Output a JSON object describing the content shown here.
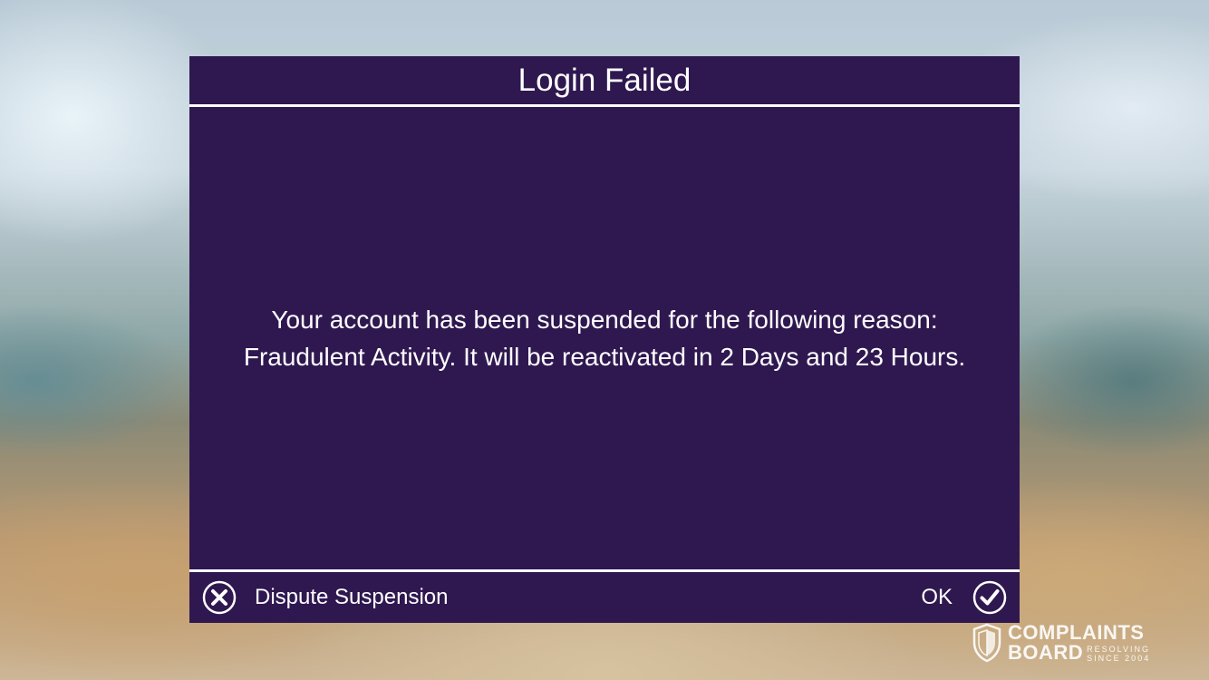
{
  "dialog": {
    "title": "Login Failed",
    "message": "Your account has been suspended for the following reason: Fraudulent Activity. It will be reactivated in 2 Days and 23 Hours.",
    "background_color": "#2f1850",
    "text_color": "#ffffff"
  },
  "footer": {
    "dispute": {
      "label": "Dispute Suspension",
      "icon": "x-circle-icon"
    },
    "ok": {
      "label": "OK",
      "icon": "check-circle-icon"
    }
  },
  "watermark": {
    "line1": "COMPLAINTS",
    "line2": "BOARD",
    "tag1": "RESOLVING",
    "tag2": "SINCE 2004",
    "icon": "shield-icon"
  }
}
